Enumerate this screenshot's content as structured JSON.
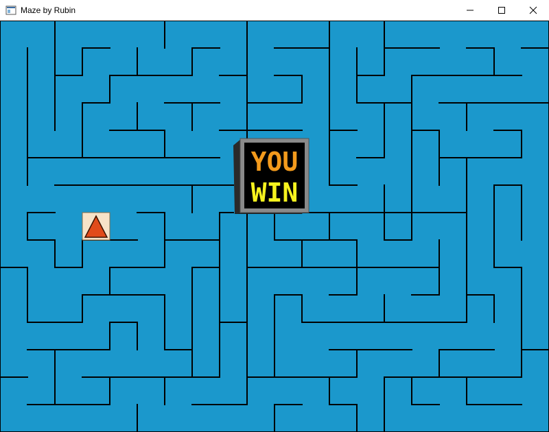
{
  "window": {
    "title": "Maze by Rubin",
    "icon": "maze-app-icon",
    "controls": [
      "minimize-icon",
      "maximize-icon",
      "close-icon"
    ]
  },
  "maze": {
    "background_color": "#1b98cc",
    "wall_color": "#000000",
    "player_icon": "triangle-icon",
    "player_color": "#e14b1a",
    "player_tile_color": "#f7e3c8"
  },
  "overlay": {
    "line1": "YOU",
    "line2": "WIN",
    "box_color": "#000000",
    "text_color_top": "#f39a1c",
    "text_color_bottom": "#f6f21e"
  }
}
